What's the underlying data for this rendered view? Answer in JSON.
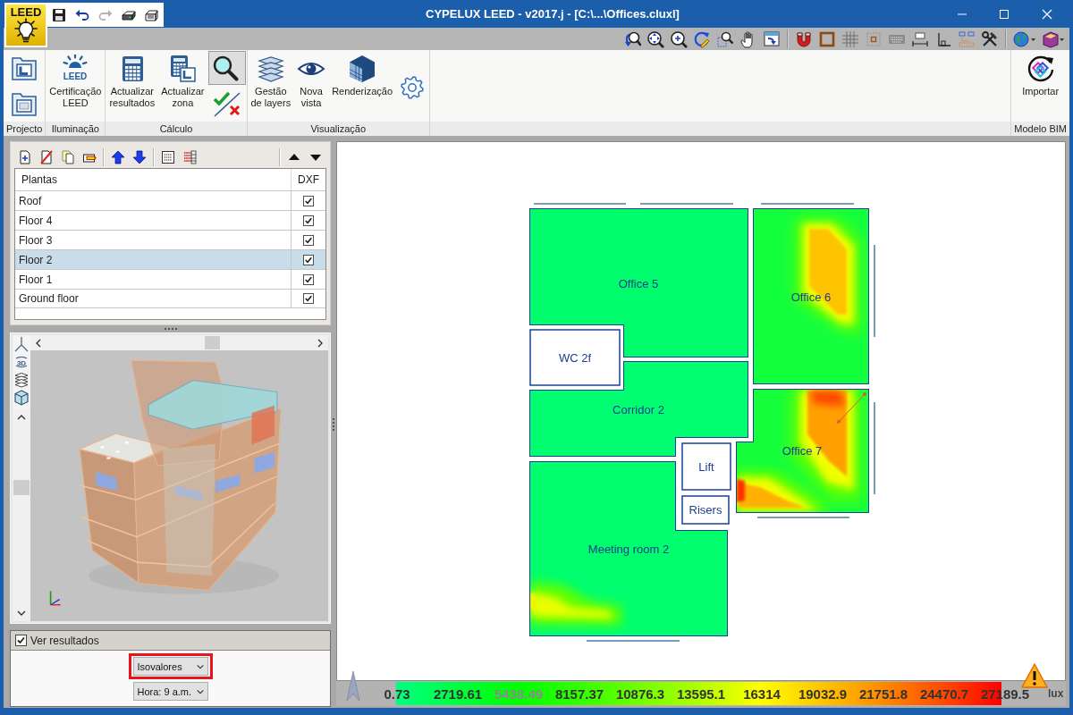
{
  "window": {
    "title": "CYPELUX LEED - v2017.j - [C:\\...\\Offices.cluxl]"
  },
  "logo": {
    "text": "LEED"
  },
  "quick_access": {
    "save": {
      "disabled": false
    },
    "undo": {
      "disabled": false
    },
    "redo": {
      "disabled": true
    },
    "print": {
      "disabled": false
    },
    "print_preview": {
      "disabled": false
    }
  },
  "ribbon": {
    "groups": [
      {
        "label": "Projecto",
        "buttons": [
          {
            "kind": "plan-open"
          },
          {
            "kind": "plan-blank"
          }
        ]
      },
      {
        "label": "Iluminação",
        "buttons": [
          {
            "kind": "leed",
            "badge": "LEED",
            "label": [
              "Certificação",
              "LEED"
            ]
          }
        ]
      },
      {
        "label": "Cálculo",
        "buttons": [
          {
            "kind": "calculator",
            "label": [
              "Actualizar",
              "resultados"
            ]
          },
          {
            "kind": "calculator-zone",
            "label": [
              "Actualizar",
              "zona"
            ]
          },
          {
            "kind": "magnifier",
            "pressed": true
          },
          {
            "kind": "check-cross"
          }
        ]
      },
      {
        "label": "Visualização",
        "buttons": [
          {
            "kind": "layers",
            "label": [
              "Gestão",
              "de layers"
            ]
          },
          {
            "kind": "eye",
            "label": [
              "Nova",
              "vista"
            ]
          },
          {
            "kind": "render",
            "label": [
              "Renderização"
            ]
          },
          {
            "kind": "gear"
          }
        ]
      },
      {
        "label": "Modelo BIM",
        "buttons": [
          {
            "kind": "import",
            "label": [
              "Importar"
            ]
          }
        ]
      }
    ]
  },
  "floors": {
    "columns": [
      "Plantas",
      "DXF"
    ],
    "rows": [
      {
        "name": "Roof",
        "dxf": true,
        "selected": false
      },
      {
        "name": "Floor 4",
        "dxf": true,
        "selected": false
      },
      {
        "name": "Floor 3",
        "dxf": true,
        "selected": false
      },
      {
        "name": "Floor 2",
        "dxf": true,
        "selected": true
      },
      {
        "name": "Floor 1",
        "dxf": true,
        "selected": false
      },
      {
        "name": "Ground floor",
        "dxf": true,
        "selected": false
      }
    ]
  },
  "view_3d": {
    "badge": "3D"
  },
  "results": {
    "show": {
      "label": "Ver resultados",
      "checked": true
    },
    "mode": {
      "value": "Isovalores",
      "highlighted": true
    },
    "hour": {
      "value": "Hora: 9 a.m.",
      "highlighted": false
    }
  },
  "plan": {
    "rooms": [
      {
        "name": "Office 5",
        "kind": "heatmap"
      },
      {
        "name": "Office 6",
        "kind": "heatmap"
      },
      {
        "name": "WC 2f",
        "kind": "plain"
      },
      {
        "name": "Corridor 2",
        "kind": "heatmap"
      },
      {
        "name": "Office 7",
        "kind": "heatmap"
      },
      {
        "name": "Lift",
        "kind": "plain"
      },
      {
        "name": "Risers",
        "kind": "plain"
      },
      {
        "name": "Meeting room 2",
        "kind": "heatmap"
      }
    ]
  },
  "legend": {
    "labels": [
      {
        "text": "0.73",
        "muted": false
      },
      {
        "text": "2719.61",
        "muted": false
      },
      {
        "text": "5438.49",
        "muted": true
      },
      {
        "text": "8157.37",
        "muted": false
      },
      {
        "text": "10876.3",
        "muted": false
      },
      {
        "text": "13595.1",
        "muted": false
      },
      {
        "text": "16314",
        "muted": false
      },
      {
        "text": "19032.9",
        "muted": false
      },
      {
        "text": "21751.8",
        "muted": false
      },
      {
        "text": "24470.7",
        "muted": false
      },
      {
        "text": "27189.5",
        "muted": false
      }
    ],
    "unit": "lux"
  }
}
